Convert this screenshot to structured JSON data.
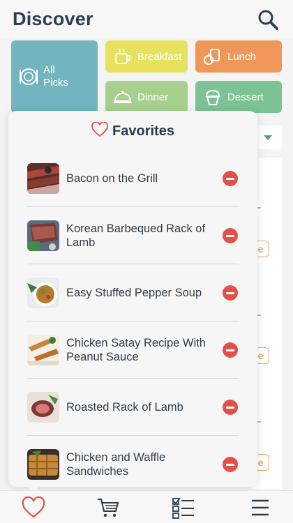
{
  "header": {
    "title": "Discover",
    "search_icon": "search-icon"
  },
  "categories": {
    "all_picks": "All Picks",
    "breakfast": "Breakfast",
    "lunch": "Lunch",
    "dinner": "Dinner",
    "dessert": "Dessert"
  },
  "favorites": {
    "title": "Favorites",
    "items": [
      {
        "name": "Bacon on the Grill"
      },
      {
        "name": "Korean Barbequed Rack of Lamb"
      },
      {
        "name": "Easy Stuffed Pepper Soup"
      },
      {
        "name": "Chicken Satay Recipe With Peanut Sauce"
      },
      {
        "name": "Roasted Rack of Lamb"
      },
      {
        "name": "Chicken and Waffle Sandwiches"
      }
    ]
  },
  "background_tags": [
    "pe",
    "pe",
    "pe"
  ],
  "tabbar": {
    "items": [
      "heart-icon",
      "cart-icon",
      "checklist-icon",
      "menu-icon"
    ],
    "active": "heart-icon"
  },
  "colors": {
    "remove": "#e2504a",
    "accent": "#e2504a",
    "all_picks": "#72b5bf",
    "breakfast": "#e6e15e",
    "lunch": "#ef9759",
    "dinner": "#a7d08f",
    "dessert": "#7cc295"
  }
}
